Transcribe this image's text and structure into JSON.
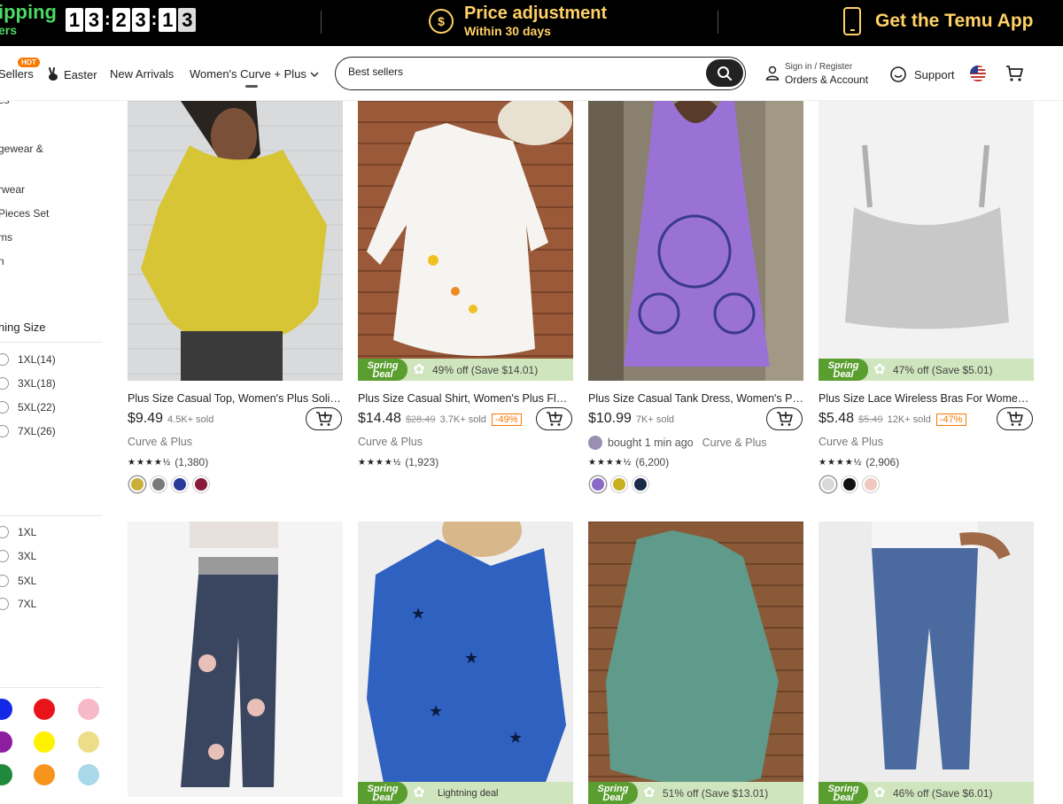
{
  "promo": {
    "shipping_line1": "ipping",
    "shipping_line2": "ers",
    "countdown": [
      "1",
      "3",
      ":",
      "2",
      "3",
      ":",
      "1",
      "3"
    ],
    "price_title": "Price adjustment",
    "price_sub": "Within 30 days",
    "app_label": "Get the Temu App"
  },
  "nav": {
    "items": [
      "Sellers",
      "Easter",
      "New Arrivals",
      "Women's Curve + Plus"
    ],
    "hot_badge": "HOT",
    "search_value": "Best sellers",
    "account_line1": "Sign in / Register",
    "account_line2": "Orders & Account",
    "support": "Support"
  },
  "sidebar": {
    "categories": [
      "es",
      "gewear &",
      "rwear",
      "Pieces Set",
      "ms",
      "n"
    ],
    "clothing_size_heading": "ning Size",
    "clothing_sizes": [
      "1XL(14)",
      "3XL(18)",
      "5XL(22)",
      "7XL(26)"
    ],
    "bottom_sizes": [
      "1XL",
      "3XL",
      "5XL",
      "7XL"
    ],
    "colors": [
      "#1428e8",
      "#e8141a",
      "#f7b8c8",
      "#8e1ea0",
      "#fff200",
      "#eedd88",
      "#1f8a3c",
      "#f7941d",
      "#a8d8ea"
    ]
  },
  "products": [
    {
      "title": "Plus Size Casual Top, Women's Plus Solid Half Sleeve",
      "price": "$9.49",
      "orig": "",
      "sold": "4.5K+ sold",
      "pct": "",
      "deal": "",
      "bought": "",
      "brand": "Curve & Plus",
      "stars": "★★★★½",
      "reviews": "(1,380)",
      "swatches": [
        "#c8b03a",
        "#7a7a7a",
        "#2a3a9a",
        "#8a1a3a"
      ]
    },
    {
      "title": "Plus Size Casual Shirt, Women's Plus Floral Print",
      "price": "$14.48",
      "orig": "$28.49",
      "sold": "3.7K+ sold",
      "pct": "-49%",
      "deal": "49% off (Save $14.01)",
      "bought": "",
      "brand": "Curve & Plus",
      "stars": "★★★★½",
      "reviews": "(1,923)",
      "swatches": []
    },
    {
      "title": "Plus Size Casual Tank Dress, Women's Plus Print",
      "price": "$10.99",
      "orig": "",
      "sold": "7K+ sold",
      "pct": "",
      "deal": "",
      "bought": "bought 1 min ago",
      "brand": "Curve & Plus",
      "stars": "★★★★½",
      "reviews": "(6,200)",
      "swatches": [
        "#8a6ac8",
        "#c8b020",
        "#1a2a4a"
      ]
    },
    {
      "title": "Plus Size Lace Wireless Bras For Women, Plus",
      "price": "$5.48",
      "orig": "$5.49",
      "sold": "12K+ sold",
      "pct": "-47%",
      "deal": "47% off (Save $5.01)",
      "bought": "",
      "brand": "Curve & Plus",
      "stars": "★★★★½",
      "reviews": "(2,906)",
      "swatches": [
        "#d8d8d8",
        "#111111",
        "#f0c8c0"
      ]
    },
    {
      "title": "",
      "price": "",
      "deal": ""
    },
    {
      "title": "",
      "price": "",
      "deal": "Lightning deal"
    },
    {
      "title": "",
      "price": "",
      "deal": "51% off (Save $13.01)"
    },
    {
      "title": "",
      "price": "",
      "deal": "46% off (Save $6.01)"
    }
  ],
  "deal_badge": "Spring Deal",
  "icons": {
    "search": "search-icon",
    "cart": "cart-icon",
    "user": "user-icon",
    "support": "support-icon",
    "dollar": "dollar-cycle-icon",
    "phone": "phone-icon",
    "easter": "bunny-icon"
  }
}
